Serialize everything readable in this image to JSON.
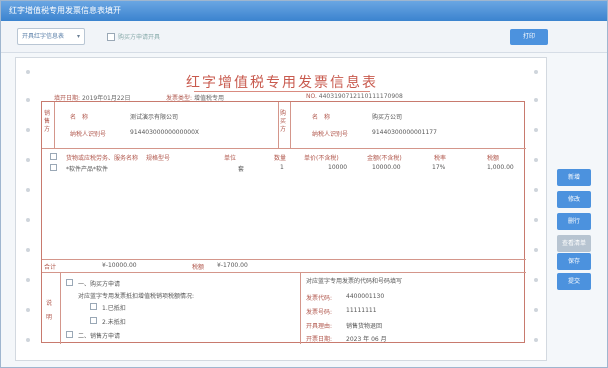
{
  "window": {
    "title": "红字增值税专用发票信息表填开"
  },
  "toolbar": {
    "select_value": "开具红字信息表",
    "checkbox_label": "购买方申请开具",
    "top_button": "打印"
  },
  "form": {
    "title": "红字增值税专用发票信息表",
    "meta": {
      "date_label": "填开日期:",
      "date_value": "2019年01月22日",
      "type_label": "发票类型:",
      "type_value": "增值税专用",
      "no_label": "NO.",
      "no_value": "4403190712110111170908"
    },
    "seller": {
      "section_label": "销售方",
      "name_label": "名　称",
      "name_value": "测试演示有限公司",
      "tax_label": "纳税人识别号",
      "tax_value": "91440300000000000X"
    },
    "buyer": {
      "section_label": "购买方",
      "name_label": "名　称",
      "name_value": "购买方公司",
      "tax_label": "纳税人识别号",
      "tax_value": "91440300000001177"
    },
    "table": {
      "headers": [
        "货物或应税劳务、服务名称",
        "规格型号",
        "单位",
        "数量",
        "单价(不含税)",
        "金额(不含税)",
        "税率",
        "税额"
      ],
      "rows": [
        [
          "*软件产品*软件",
          "",
          "套",
          "1",
          "10000",
          "10000.00",
          "17%",
          "1,000.00"
        ]
      ]
    },
    "totals": {
      "label": "合计",
      "amount": "¥-10000.00",
      "tax_label": "税额",
      "tax": "¥-1700.00"
    },
    "notes": {
      "section_label": "说明",
      "opt1": "一、购买方申请",
      "opt1_sub": "对应蓝字专用发票抵扣增值税销项税额情况:",
      "opt1_a": "1.已抵扣",
      "opt1_b": "2.未抵扣",
      "opt2": "二、销售方申请"
    },
    "right_info": {
      "header": "对应蓝字专用发票的代码和号码填写",
      "code_label": "发票代码:",
      "code_value": "4400001130",
      "no_label": "发票号码:",
      "no_value": "11111111",
      "reason_label": "开具理由:",
      "reason_value": "销售货物退回",
      "date_label": "开票日期:",
      "date_value": "2023 年 06 月"
    }
  },
  "side_buttons": [
    "新增",
    "修改",
    "删行",
    "查看清单",
    "保存",
    "提交"
  ]
}
